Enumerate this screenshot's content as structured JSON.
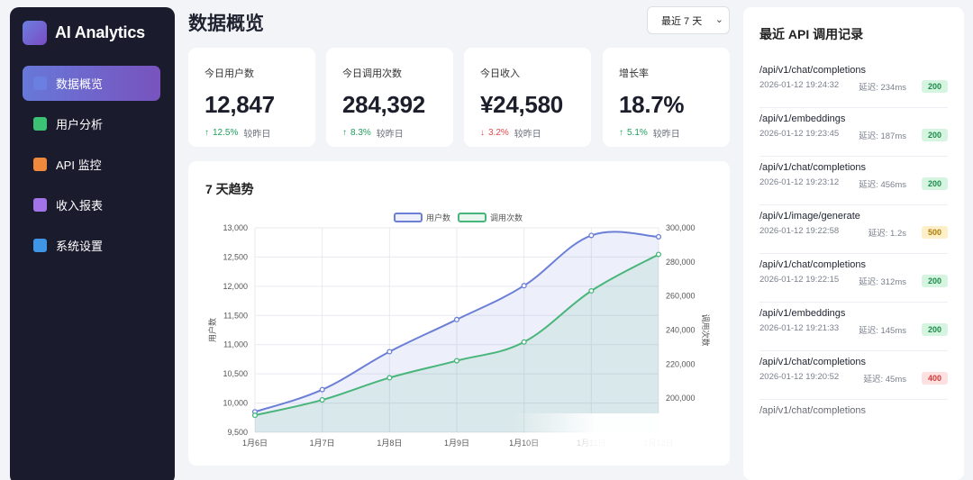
{
  "brand": {
    "name": "AI Analytics"
  },
  "nav": [
    {
      "label": "数据概览",
      "icon": "overview-icon",
      "color": "#6b7fe0",
      "active": true
    },
    {
      "label": "用户分析",
      "icon": "users-icon",
      "color": "#3cc275"
    },
    {
      "label": "API 监控",
      "icon": "monitor-icon",
      "color": "#ef8a3c"
    },
    {
      "label": "收入报表",
      "icon": "revenue-icon",
      "color": "#a374e8"
    },
    {
      "label": "系统设置",
      "icon": "settings-icon",
      "color": "#3f95e6"
    }
  ],
  "header": {
    "title": "数据概览",
    "range": "最近 7 天"
  },
  "stats": [
    {
      "label": "今日用户数",
      "value": "12,847",
      "arrow": "↑",
      "change": "12.5%",
      "direction": "up",
      "compare": "较昨日"
    },
    {
      "label": "今日调用次数",
      "value": "284,392",
      "arrow": "↑",
      "change": "8.3%",
      "direction": "up",
      "compare": "较昨日"
    },
    {
      "label": "今日收入",
      "value": "¥24,580",
      "arrow": "↓",
      "change": "3.2%",
      "direction": "down",
      "compare": "较昨日"
    },
    {
      "label": "增长率",
      "value": "18.7%",
      "arrow": "↑",
      "change": "5.1%",
      "direction": "up",
      "compare": "较昨日"
    }
  ],
  "chart": {
    "title": "7 天趋势"
  },
  "chart_data": {
    "type": "line",
    "x": [
      "1月6日",
      "1月7日",
      "1月8日",
      "1月9日",
      "1月10日",
      "1月11日",
      "1月12日"
    ],
    "series": [
      {
        "name": "用户数",
        "axis": "left",
        "color": "#6b7fd6",
        "fill": "rgba(107,127,214,0.12)",
        "values": [
          9850,
          10230,
          10880,
          11430,
          12010,
          12870,
          12847
        ]
      },
      {
        "name": "调用次数",
        "axis": "right",
        "color": "#48b57a",
        "fill": "rgba(72,181,122,0.12)",
        "values": [
          190000,
          199000,
          212000,
          222000,
          233000,
          263000,
          284392
        ]
      }
    ],
    "ylabel_left": "用户数",
    "ylabel_right": "调用次数",
    "ylim_left": [
      9500,
      13000
    ],
    "yticks_left": [
      "9,500",
      "10,000",
      "10,500",
      "11,000",
      "11,500",
      "12,000",
      "12,500",
      "13,000"
    ],
    "ylim_right": [
      180000,
      300000
    ],
    "yticks_right": [
      "200,000",
      "220,000",
      "240,000",
      "260,000",
      "280,000",
      "300,000"
    ],
    "grid": true,
    "legend": "top-center"
  },
  "api_log": {
    "title": "最近 API 调用记录",
    "items": [
      {
        "path": "/api/v1/chat/completions",
        "time": "2026-01-12 19:24:32",
        "latency": "延迟: 234ms",
        "status": "200"
      },
      {
        "path": "/api/v1/embeddings",
        "time": "2026-01-12 19:23:45",
        "latency": "延迟: 187ms",
        "status": "200"
      },
      {
        "path": "/api/v1/chat/completions",
        "time": "2026-01-12 19:23:12",
        "latency": "延迟: 456ms",
        "status": "200"
      },
      {
        "path": "/api/v1/image/generate",
        "time": "2026-01-12 19:22:58",
        "latency": "延迟: 1.2s",
        "status": "500"
      },
      {
        "path": "/api/v1/chat/completions",
        "time": "2026-01-12 19:22:15",
        "latency": "延迟: 312ms",
        "status": "200"
      },
      {
        "path": "/api/v1/embeddings",
        "time": "2026-01-12 19:21:33",
        "latency": "延迟: 145ms",
        "status": "200"
      },
      {
        "path": "/api/v1/chat/completions",
        "time": "2026-01-12 19:20:52",
        "latency": "延迟: 45ms",
        "status": "400"
      },
      {
        "path": "/api/v1/chat/completions",
        "time": "",
        "latency": "",
        "status": ""
      }
    ]
  }
}
